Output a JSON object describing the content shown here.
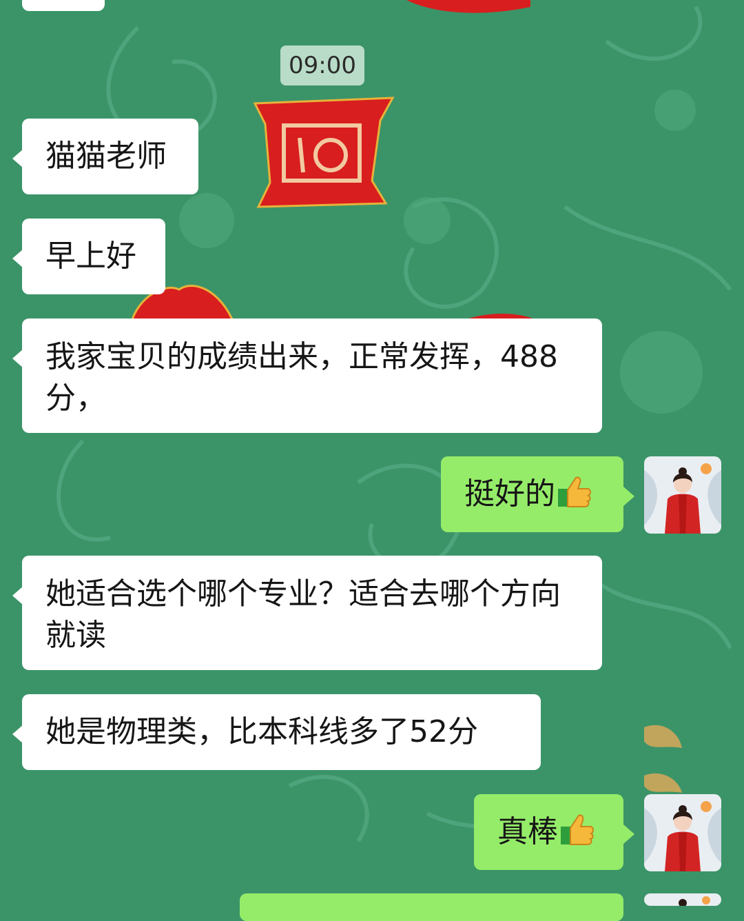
{
  "chat": {
    "timestamp": "09:00",
    "messages": [
      {
        "side": "in",
        "text": "猫猫老师"
      },
      {
        "side": "in",
        "text": "早上好"
      },
      {
        "side": "in",
        "text": "我家宝贝的成绩出来，正常发挥，488分，"
      },
      {
        "side": "out",
        "text": "挺好的",
        "emoji": "thumbs-up-icon"
      },
      {
        "side": "in",
        "text": "她适合选个哪个专业？适合去哪个方向就读"
      },
      {
        "side": "in",
        "text": "她是物理类，比本科线多了52分"
      },
      {
        "side": "out",
        "text": "真棒",
        "emoji": "thumbs-up-icon"
      }
    ]
  },
  "theme": {
    "background": "#3b9468",
    "incoming_bubble": "#ffffff",
    "outgoing_bubble": "#95ec69",
    "timestamp_pill": "#b9dcc8"
  }
}
